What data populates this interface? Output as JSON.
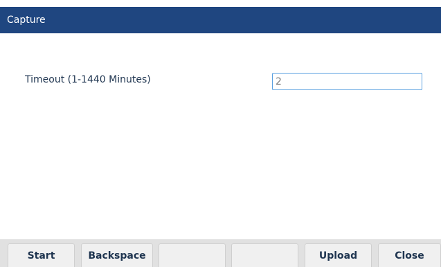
{
  "header": {
    "title": "Capture"
  },
  "form": {
    "timeout_label": "Timeout (1-1440 Minutes)",
    "timeout_value": "2"
  },
  "softkeys": [
    {
      "label": "Start"
    },
    {
      "label": "Backspace"
    },
    {
      "label": ""
    },
    {
      "label": ""
    },
    {
      "label": "Upload"
    },
    {
      "label": "Close"
    }
  ],
  "colors": {
    "title_bar": "#1f4680",
    "input_border": "#5aa0e0",
    "softkey_text": "#1f3550"
  }
}
